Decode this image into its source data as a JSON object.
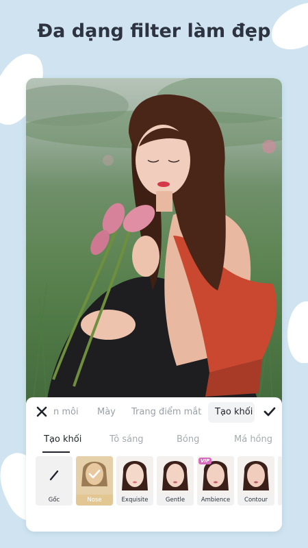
{
  "headline": "Đa dạng filter làm đẹp",
  "colors": {
    "background": "#cfe4f0",
    "vip_badge": "#d66bbd",
    "selected_tile": "#e9d2a6"
  },
  "toolbar": {
    "close_icon": "close-icon",
    "confirm_icon": "check-icon",
    "tabs": [
      {
        "label": "n môi",
        "active": false
      },
      {
        "label": "Mày",
        "active": false
      },
      {
        "label": "Trang điểm mắt",
        "active": false
      },
      {
        "label": "Tạo khối",
        "active": true
      }
    ]
  },
  "subtabs": [
    {
      "label": "Tạo khối",
      "active": true
    },
    {
      "label": "Tô sáng",
      "active": false
    },
    {
      "label": "Bóng",
      "active": false
    },
    {
      "label": "Má hồng",
      "active": false
    }
  ],
  "effects": [
    {
      "label": "Gốc",
      "icon": "slash-icon",
      "selected": false,
      "vip": false
    },
    {
      "label": "Nose",
      "icon": "check-icon",
      "selected": true,
      "vip": false
    },
    {
      "label": "Exquisite",
      "selected": false,
      "vip": false
    },
    {
      "label": "Gentle",
      "selected": false,
      "vip": false
    },
    {
      "label": "Ambience",
      "selected": false,
      "vip": true,
      "vip_label": "VIP"
    },
    {
      "label": "Contour",
      "selected": false,
      "vip": false
    }
  ]
}
